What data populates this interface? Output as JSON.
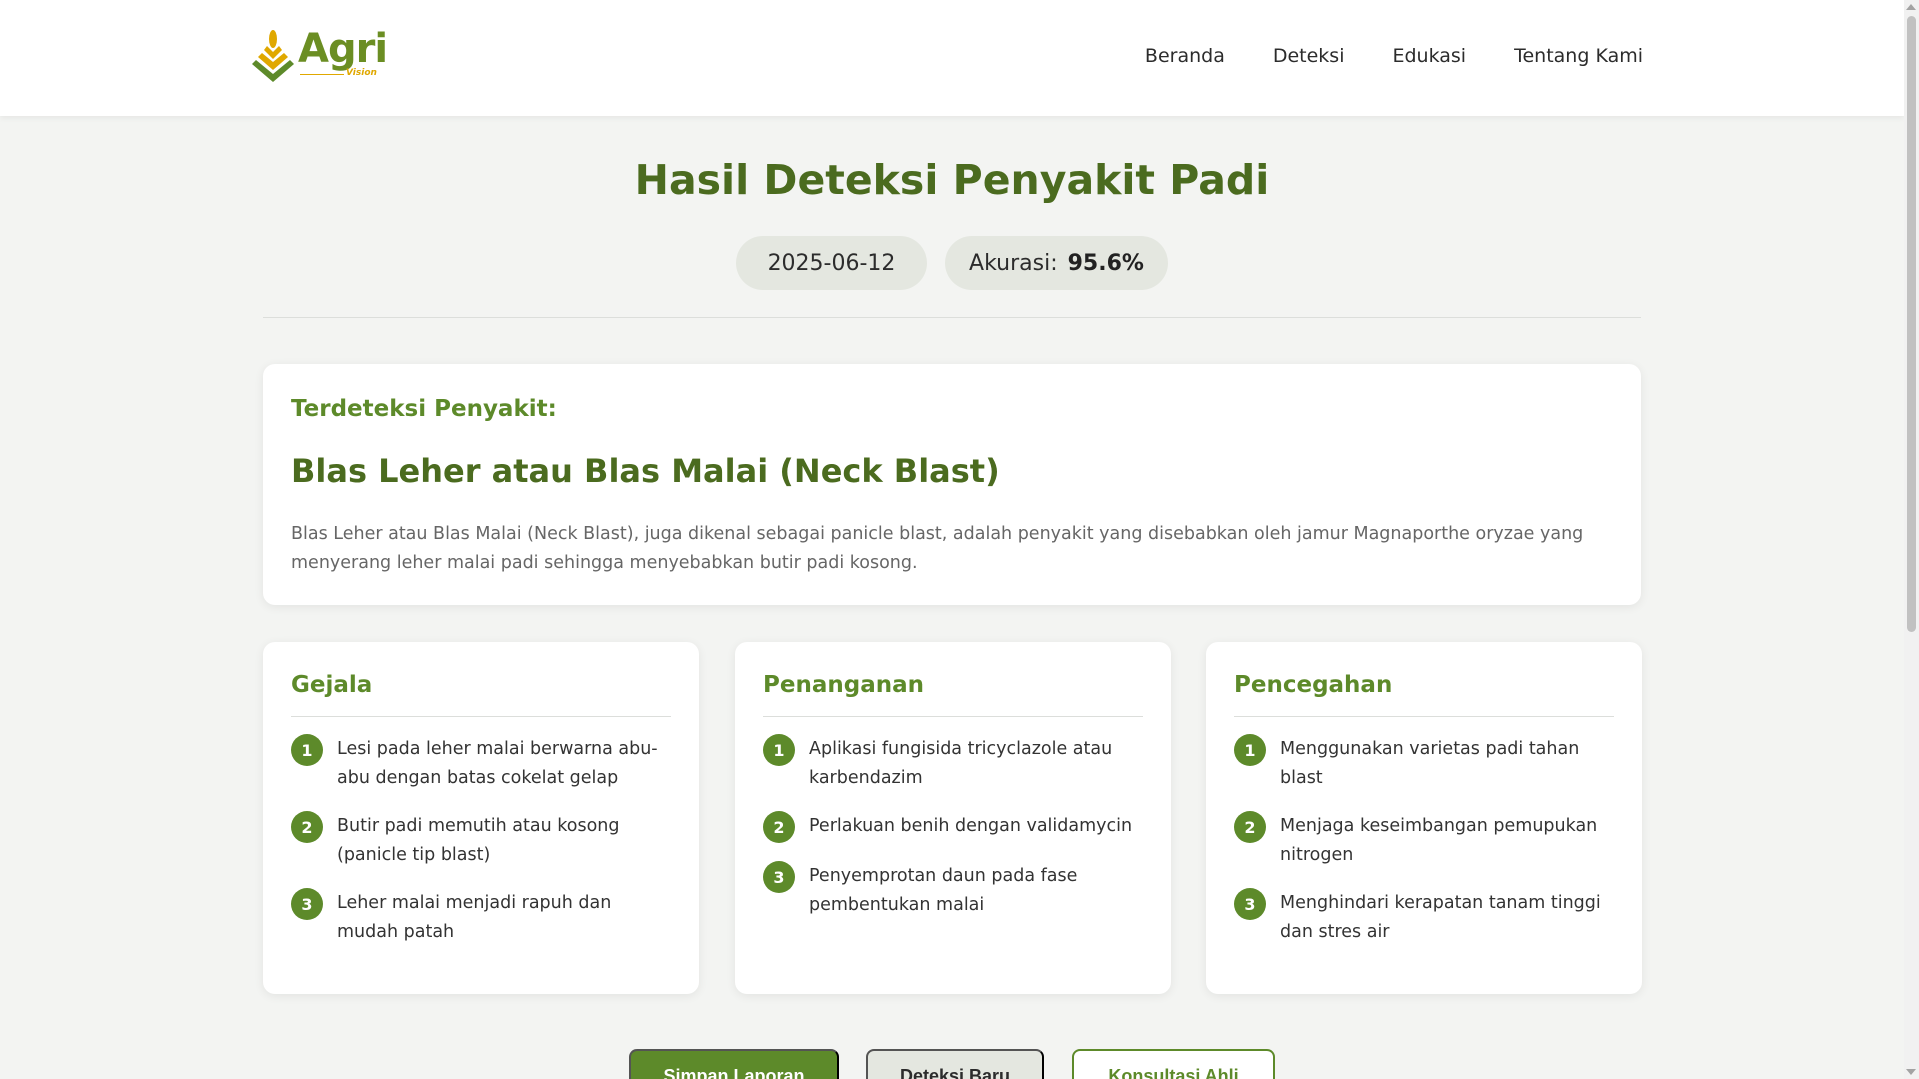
{
  "brand": {
    "name": "Agri",
    "tagline": "Vision",
    "primary_color": "#5d8a2a",
    "accent_color": "#e0a800"
  },
  "nav": {
    "items": [
      "Beranda",
      "Deteksi",
      "Edukasi",
      "Tentang Kami"
    ]
  },
  "header": {
    "title": "Hasil Deteksi Penyakit Padi",
    "date": "2025-06-12",
    "accuracy_label": "Akurasi:",
    "accuracy_value": "95.6%"
  },
  "detection": {
    "label": "Terdeteksi Penyakit:",
    "disease": "Blas Leher atau Blas Malai (Neck Blast)",
    "description": "Blas Leher atau Blas Malai (Neck Blast), juga dikenal sebagai panicle blast, adalah penyakit yang disebabkan oleh jamur Magnaporthe oryzae yang menyerang leher malai padi sehingga menyebabkan butir padi kosong."
  },
  "sections": [
    {
      "title": "Gejala",
      "items": [
        "Lesi pada leher malai berwarna abu-abu dengan batas cokelat gelap",
        "Butir padi memutih atau kosong (panicle tip blast)",
        "Leher malai menjadi rapuh dan mudah patah"
      ]
    },
    {
      "title": "Penanganan",
      "items": [
        "Aplikasi fungisida tricyclazole atau karbendazim",
        "Perlakuan benih dengan validamycin",
        "Penyemprotan daun pada fase pembentukan malai"
      ]
    },
    {
      "title": "Pencegahan",
      "items": [
        "Menggunakan varietas padi tahan blast",
        "Menjaga keseimbangan pemupukan nitrogen",
        "Menghindari kerapatan tanam tinggi dan stres air"
      ]
    }
  ],
  "numbers": [
    "1",
    "2",
    "3"
  ],
  "actions": {
    "save": "Simpan Laporan",
    "new": "Deteksi Baru",
    "consult": "Konsultasi Ahli"
  }
}
